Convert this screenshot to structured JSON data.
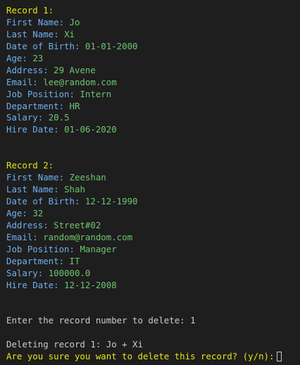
{
  "colors": {
    "background": "#1e1e1e",
    "heading": "#e5e510",
    "label": "#6fb0f0",
    "value": "#6ec56e",
    "plain": "#cccccc"
  },
  "records": [
    {
      "heading": "Record 1:",
      "fields": [
        {
          "label": "First Name: ",
          "value": "Jo"
        },
        {
          "label": "Last Name: ",
          "value": "Xi"
        },
        {
          "label": "Date of Birth: ",
          "value": "01-01-2000"
        },
        {
          "label": "Age: ",
          "value": "23"
        },
        {
          "label": "Address: ",
          "value": "29 Avene"
        },
        {
          "label": "Email: ",
          "value": "lee@random.com"
        },
        {
          "label": "Job Position: ",
          "value": "Intern"
        },
        {
          "label": "Department: ",
          "value": "HR"
        },
        {
          "label": "Salary: ",
          "value": "20.5"
        },
        {
          "label": "Hire Date: ",
          "value": "01-06-2020"
        }
      ]
    },
    {
      "heading": "Record 2:",
      "fields": [
        {
          "label": "First Name: ",
          "value": "Zeeshan"
        },
        {
          "label": "Last Name: ",
          "value": "Shah"
        },
        {
          "label": "Date of Birth: ",
          "value": "12-12-1990"
        },
        {
          "label": "Age: ",
          "value": "32"
        },
        {
          "label": "Address: ",
          "value": "Street#02"
        },
        {
          "label": "Email: ",
          "value": "random@random.com"
        },
        {
          "label": "Job Position: ",
          "value": "Manager"
        },
        {
          "label": "Department: ",
          "value": "IT"
        },
        {
          "label": "Salary: ",
          "value": "100000.0"
        },
        {
          "label": "Hire Date: ",
          "value": "12-12-2008"
        }
      ]
    }
  ],
  "prompt": {
    "record_number_text": "Enter the record number to delete: 1",
    "deleting_text": "Deleting record 1: Jo + Xi",
    "confirm_text": "Are you sure you want to delete this record? (y/n):"
  }
}
